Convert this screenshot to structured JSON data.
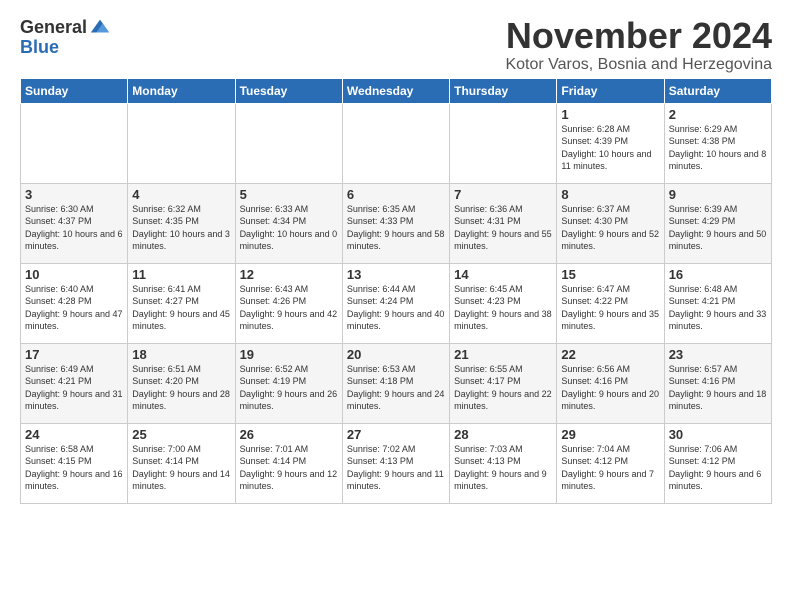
{
  "logo": {
    "general": "General",
    "blue": "Blue"
  },
  "title": "November 2024",
  "location": "Kotor Varos, Bosnia and Herzegovina",
  "headers": [
    "Sunday",
    "Monday",
    "Tuesday",
    "Wednesday",
    "Thursday",
    "Friday",
    "Saturday"
  ],
  "weeks": [
    [
      {
        "day": "",
        "info": ""
      },
      {
        "day": "",
        "info": ""
      },
      {
        "day": "",
        "info": ""
      },
      {
        "day": "",
        "info": ""
      },
      {
        "day": "",
        "info": ""
      },
      {
        "day": "1",
        "info": "Sunrise: 6:28 AM\nSunset: 4:39 PM\nDaylight: 10 hours and 11 minutes."
      },
      {
        "day": "2",
        "info": "Sunrise: 6:29 AM\nSunset: 4:38 PM\nDaylight: 10 hours and 8 minutes."
      }
    ],
    [
      {
        "day": "3",
        "info": "Sunrise: 6:30 AM\nSunset: 4:37 PM\nDaylight: 10 hours and 6 minutes."
      },
      {
        "day": "4",
        "info": "Sunrise: 6:32 AM\nSunset: 4:35 PM\nDaylight: 10 hours and 3 minutes."
      },
      {
        "day": "5",
        "info": "Sunrise: 6:33 AM\nSunset: 4:34 PM\nDaylight: 10 hours and 0 minutes."
      },
      {
        "day": "6",
        "info": "Sunrise: 6:35 AM\nSunset: 4:33 PM\nDaylight: 9 hours and 58 minutes."
      },
      {
        "day": "7",
        "info": "Sunrise: 6:36 AM\nSunset: 4:31 PM\nDaylight: 9 hours and 55 minutes."
      },
      {
        "day": "8",
        "info": "Sunrise: 6:37 AM\nSunset: 4:30 PM\nDaylight: 9 hours and 52 minutes."
      },
      {
        "day": "9",
        "info": "Sunrise: 6:39 AM\nSunset: 4:29 PM\nDaylight: 9 hours and 50 minutes."
      }
    ],
    [
      {
        "day": "10",
        "info": "Sunrise: 6:40 AM\nSunset: 4:28 PM\nDaylight: 9 hours and 47 minutes."
      },
      {
        "day": "11",
        "info": "Sunrise: 6:41 AM\nSunset: 4:27 PM\nDaylight: 9 hours and 45 minutes."
      },
      {
        "day": "12",
        "info": "Sunrise: 6:43 AM\nSunset: 4:26 PM\nDaylight: 9 hours and 42 minutes."
      },
      {
        "day": "13",
        "info": "Sunrise: 6:44 AM\nSunset: 4:24 PM\nDaylight: 9 hours and 40 minutes."
      },
      {
        "day": "14",
        "info": "Sunrise: 6:45 AM\nSunset: 4:23 PM\nDaylight: 9 hours and 38 minutes."
      },
      {
        "day": "15",
        "info": "Sunrise: 6:47 AM\nSunset: 4:22 PM\nDaylight: 9 hours and 35 minutes."
      },
      {
        "day": "16",
        "info": "Sunrise: 6:48 AM\nSunset: 4:21 PM\nDaylight: 9 hours and 33 minutes."
      }
    ],
    [
      {
        "day": "17",
        "info": "Sunrise: 6:49 AM\nSunset: 4:21 PM\nDaylight: 9 hours and 31 minutes."
      },
      {
        "day": "18",
        "info": "Sunrise: 6:51 AM\nSunset: 4:20 PM\nDaylight: 9 hours and 28 minutes."
      },
      {
        "day": "19",
        "info": "Sunrise: 6:52 AM\nSunset: 4:19 PM\nDaylight: 9 hours and 26 minutes."
      },
      {
        "day": "20",
        "info": "Sunrise: 6:53 AM\nSunset: 4:18 PM\nDaylight: 9 hours and 24 minutes."
      },
      {
        "day": "21",
        "info": "Sunrise: 6:55 AM\nSunset: 4:17 PM\nDaylight: 9 hours and 22 minutes."
      },
      {
        "day": "22",
        "info": "Sunrise: 6:56 AM\nSunset: 4:16 PM\nDaylight: 9 hours and 20 minutes."
      },
      {
        "day": "23",
        "info": "Sunrise: 6:57 AM\nSunset: 4:16 PM\nDaylight: 9 hours and 18 minutes."
      }
    ],
    [
      {
        "day": "24",
        "info": "Sunrise: 6:58 AM\nSunset: 4:15 PM\nDaylight: 9 hours and 16 minutes."
      },
      {
        "day": "25",
        "info": "Sunrise: 7:00 AM\nSunset: 4:14 PM\nDaylight: 9 hours and 14 minutes."
      },
      {
        "day": "26",
        "info": "Sunrise: 7:01 AM\nSunset: 4:14 PM\nDaylight: 9 hours and 12 minutes."
      },
      {
        "day": "27",
        "info": "Sunrise: 7:02 AM\nSunset: 4:13 PM\nDaylight: 9 hours and 11 minutes."
      },
      {
        "day": "28",
        "info": "Sunrise: 7:03 AM\nSunset: 4:13 PM\nDaylight: 9 hours and 9 minutes."
      },
      {
        "day": "29",
        "info": "Sunrise: 7:04 AM\nSunset: 4:12 PM\nDaylight: 9 hours and 7 minutes."
      },
      {
        "day": "30",
        "info": "Sunrise: 7:06 AM\nSunset: 4:12 PM\nDaylight: 9 hours and 6 minutes."
      }
    ]
  ]
}
